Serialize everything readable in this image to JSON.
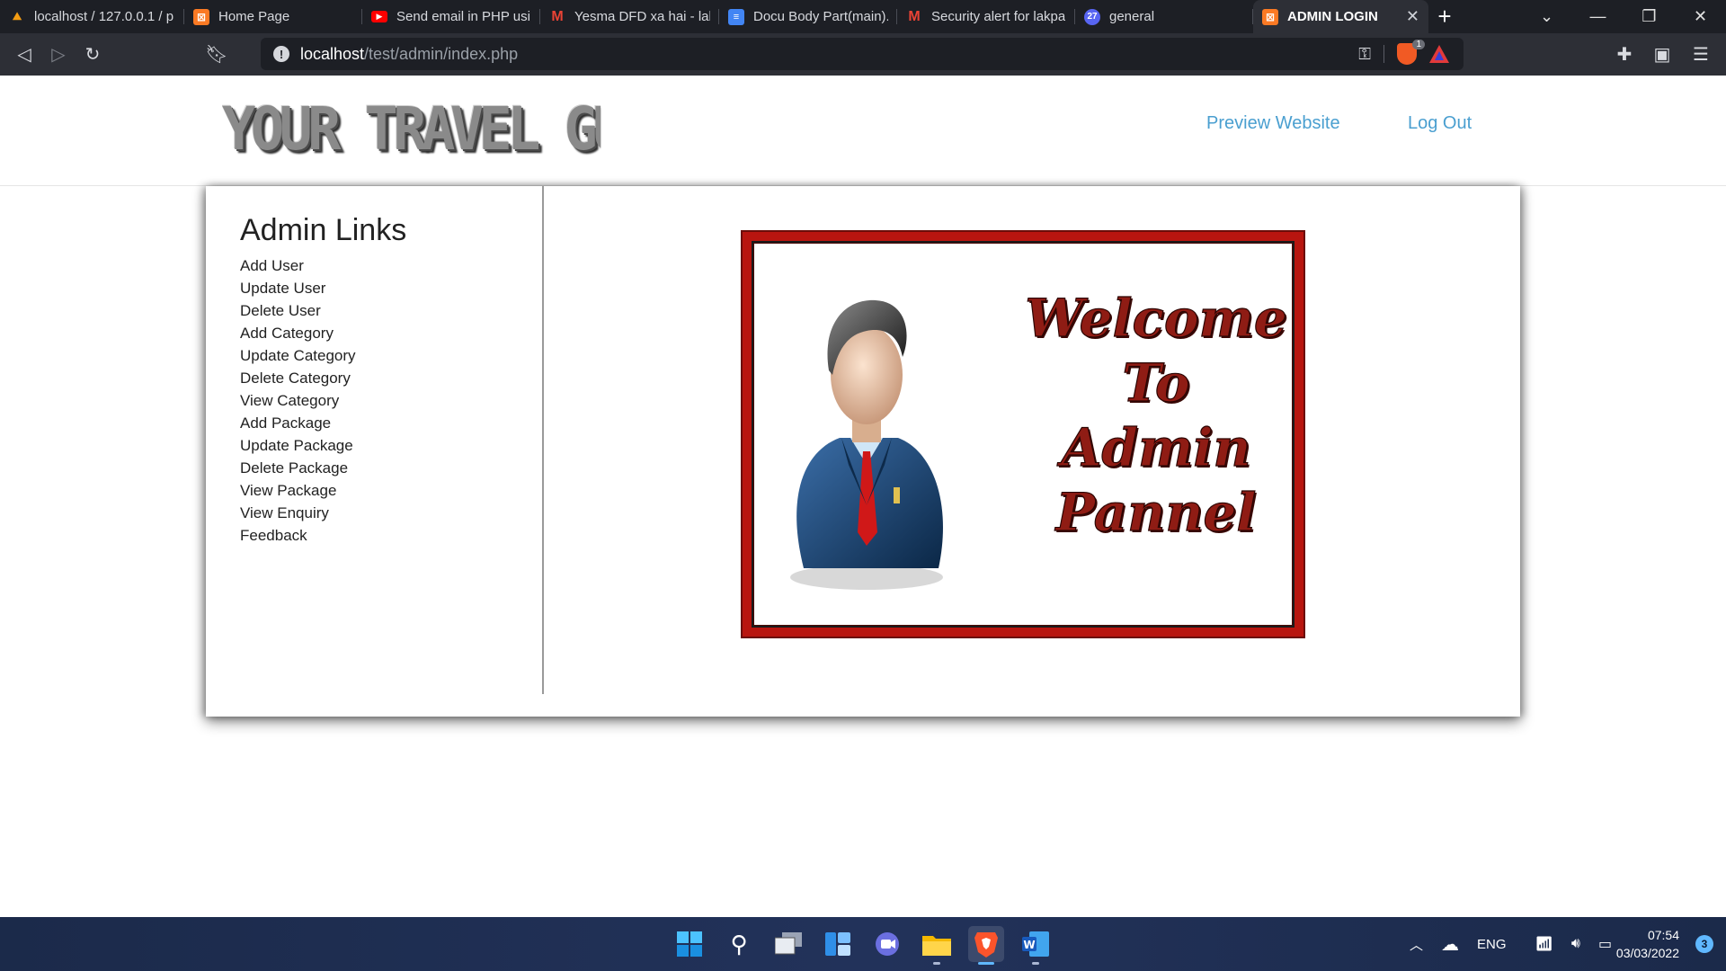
{
  "browser": {
    "tabs": [
      {
        "title": "localhost / 127.0.0.1 / p",
        "icon": "phpmyadmin-icon"
      },
      {
        "title": "Home Page",
        "icon": "xampp-icon"
      },
      {
        "title": "Send email in PHP usin",
        "icon": "youtube-icon"
      },
      {
        "title": "Yesma DFD xa hai - lak",
        "icon": "gmail-icon"
      },
      {
        "title": "Docu Body Part(main).",
        "icon": "google-docs-icon"
      },
      {
        "title": "Security alert for lakpa",
        "icon": "gmail-icon"
      },
      {
        "title": "general",
        "icon": "chat-icon",
        "badge": "27"
      },
      {
        "title": "ADMIN LOGIN",
        "icon": "xampp-icon",
        "active": true
      }
    ],
    "url_host": "localhost",
    "url_path": "/test/admin/index.php",
    "shield_count": "1"
  },
  "header": {
    "logo_text": "YOUR TRAVEL GUIDE",
    "nav": {
      "preview_label": "Preview Website",
      "logout_label": "Log Out"
    }
  },
  "sidebar": {
    "title": "Admin Links",
    "links": [
      "Add User",
      "Update User",
      "Delete User",
      "Add Category",
      "Update Category",
      "Delete Category",
      "View Category",
      "Add Package",
      "Update Package",
      "Delete Package",
      "View Package",
      "View Enquiry",
      "Feedback"
    ]
  },
  "welcome": {
    "lines": [
      "Welcome",
      "To",
      "Admin",
      "Pannel"
    ]
  },
  "taskbar": {
    "language": "ENG",
    "time": "07:54",
    "date": "03/03/2022",
    "notification_count": "3"
  },
  "colors": {
    "link_blue": "#4a9fd0",
    "frame_red": "#b8150f",
    "taskbar": "#22325a"
  }
}
